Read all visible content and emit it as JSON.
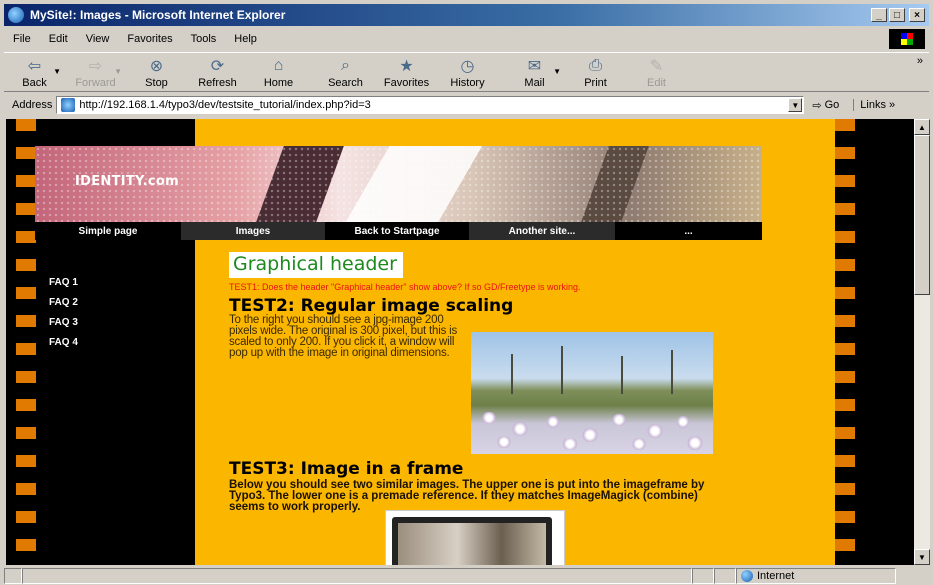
{
  "window": {
    "title": "MySite!: Images - Microsoft Internet Explorer",
    "minimize": "_",
    "maximize": "□",
    "close": "×"
  },
  "menu": [
    "File",
    "Edit",
    "View",
    "Favorites",
    "Tools",
    "Help"
  ],
  "toolbar": {
    "back": "Back",
    "forward": "Forward",
    "stop": "Stop",
    "refresh": "Refresh",
    "home": "Home",
    "search": "Search",
    "favorites": "Favorites",
    "history": "History",
    "mail": "Mail",
    "print": "Print",
    "edit": "Edit",
    "more": "»"
  },
  "address": {
    "label": "Address",
    "url": "http://192.168.1.4/typo3/dev/testsite_tutorial/index.php?id=3",
    "go": "Go",
    "links": "Links »"
  },
  "site": {
    "logo": "IDENTITY.com",
    "nav": [
      "Simple page",
      "Images",
      "Back to Startpage",
      "Another site...",
      "..."
    ],
    "active_nav": "Images",
    "left_menu": [
      "FAQ 1",
      "FAQ 2",
      "FAQ 3",
      "FAQ 4"
    ]
  },
  "content": {
    "graphical_header": "Graphical header",
    "test1": "TEST1: Does the header \"Graphical header\" show above? If so GD/Freetype is working.",
    "test2_heading": "TEST2: Regular image scaling",
    "test2_body": "To the right you should see a jpg-image 200 pixels wide. The original is 300 pixel, but this is scaled to only 200. If you click it, a window will pop up with the image in original dimensions.",
    "test3_heading": "TEST3: Image in a frame",
    "test3_body": "Below you should see two similar images. The upper one is put into the imageframe by Typo3. The lower one is a premade reference. If they matches ImageMagick (combine) seems to work properly."
  },
  "status": {
    "zone": "Internet"
  },
  "colors": {
    "page_background": "#fbb600",
    "title_bar": "#0a246a",
    "graphical_header_text": "#1e8a1e",
    "test1_text": "#e11111"
  }
}
